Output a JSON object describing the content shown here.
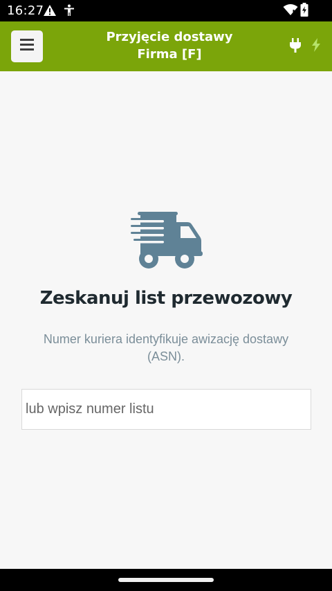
{
  "status_bar": {
    "time": "16:27",
    "icons": [
      "warning-icon",
      "accessibility-icon",
      "wifi-icon",
      "battery-charging-icon"
    ]
  },
  "header": {
    "menu_icon": "hamburger-icon",
    "title_line1": "Przyjęcie dostawy",
    "title_line2": "Firma [F]",
    "status_icons": [
      "plug-icon",
      "bolt-icon"
    ],
    "color": "#7ba50a"
  },
  "main": {
    "illustration": "delivery-truck-icon",
    "illustration_color": "#5f8296",
    "heading": "Zeskanuj list przewozowy",
    "description": "Numer kuriera identyfikuje awizację dostawy (ASN).",
    "waybill_input": {
      "value": "",
      "placeholder": "lub wpisz numer listu"
    }
  }
}
